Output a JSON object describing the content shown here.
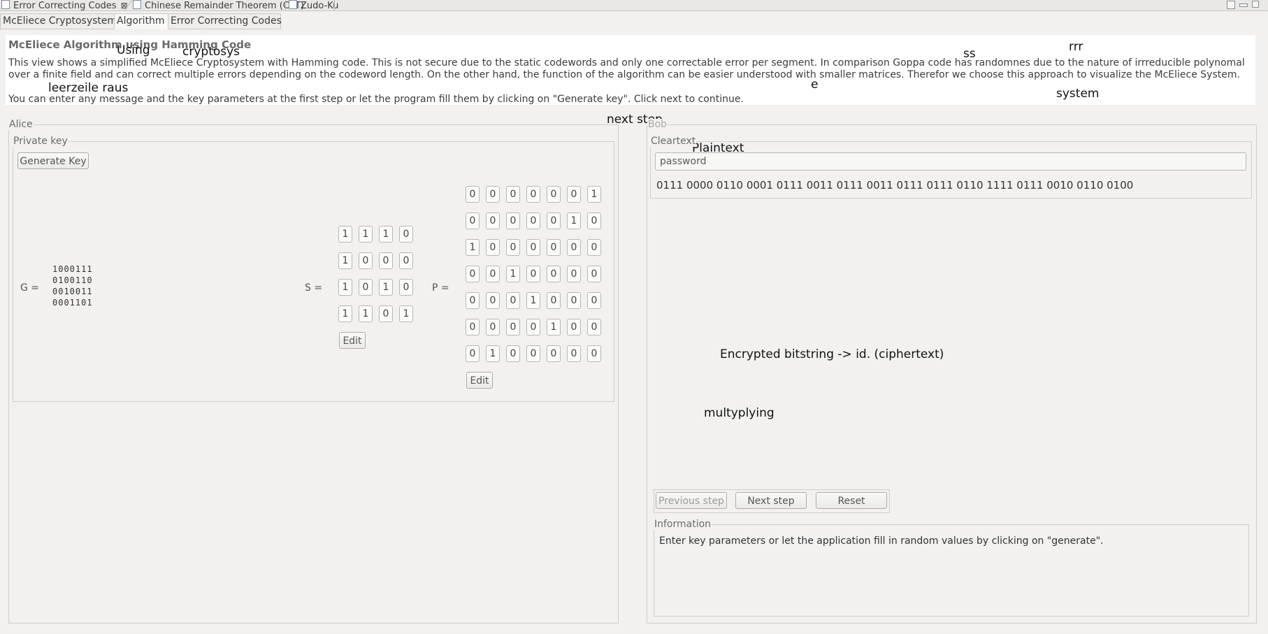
{
  "editor_tabs": [
    {
      "label": "Error Correcting Codes",
      "closable": true
    },
    {
      "label": "Chinese Remainder Theorem (CRT)"
    },
    {
      "label": "Zudo-Ku"
    }
  ],
  "close_glyph": "⊠",
  "sub_tabs": [
    "McEliece Cryptosystem",
    "Algorithm",
    "Error Correcting Codes"
  ],
  "active_sub_tab": "Algorithm",
  "header": {
    "title": "McEliece Algorithm using Hamming Code",
    "description": "This view shows a simplified McEliece Cryptosystem with Hamming code. This is not secure due to the static codewords and only one correctable error per segment. In comparison Goppa code has randomnes due to the nature of irrreducible polynomal over a finite field and can correct multiple errors depending on the codeword length. On the other hand, the function of the algorithm can be easier understood with smaller matrices. Therefor we choose this approach to visualize the McEliece System.",
    "instructions": "You can enter any message and the key parameters at the first step or let the program fill them by clicking on \"Generate key\". Click next to continue."
  },
  "annotations": {
    "using": "Using",
    "cryptosys": "cryptosys",
    "leerzeile": "leerzeile raus",
    "ss": "ss",
    "rrr": "rrr",
    "e": "e",
    "system": "system",
    "next_step": "next step",
    "plaintext": "Plaintext",
    "encrypted": "Encrypted bitstring -> id. (ciphertext)",
    "multyplying": "multyplying"
  },
  "alice": {
    "label": "Alice",
    "private_key_label": "Private key",
    "generate_key_label": "Generate Key",
    "g_label": "G =",
    "g_rows": [
      "1000111",
      "0100110",
      "0010011",
      "0001101"
    ],
    "s_label": "S =",
    "s_matrix": [
      [
        "1",
        "1",
        "1",
        "0"
      ],
      [
        "1",
        "0",
        "0",
        "0"
      ],
      [
        "1",
        "0",
        "1",
        "0"
      ],
      [
        "1",
        "1",
        "0",
        "1"
      ]
    ],
    "s_edit_label": "Edit",
    "p_label": "P =",
    "p_matrix": [
      [
        "0",
        "0",
        "0",
        "0",
        "0",
        "0",
        "1"
      ],
      [
        "0",
        "0",
        "0",
        "0",
        "0",
        "1",
        "0"
      ],
      [
        "1",
        "0",
        "0",
        "0",
        "0",
        "0",
        "0"
      ],
      [
        "0",
        "0",
        "1",
        "0",
        "0",
        "0",
        "0"
      ],
      [
        "0",
        "0",
        "0",
        "1",
        "0",
        "0",
        "0"
      ],
      [
        "0",
        "0",
        "0",
        "0",
        "1",
        "0",
        "0"
      ],
      [
        "0",
        "1",
        "0",
        "0",
        "0",
        "0",
        "0"
      ]
    ],
    "p_edit_label": "Edit"
  },
  "bob": {
    "label": "Bob",
    "cleartext_label": "Cleartext",
    "cleartext_value": "password",
    "bitstring": "0111 0000 0110 0001 0111 0011 0111 0011 0111 0111 0110 1111 0111 0010 0110 0100",
    "previous_step_label": "Previous step",
    "next_step_label": "Next step",
    "reset_label": "Reset",
    "information_label": "Information",
    "information_text": "Enter key parameters or let the application fill in random values by clicking on \"generate\"."
  }
}
